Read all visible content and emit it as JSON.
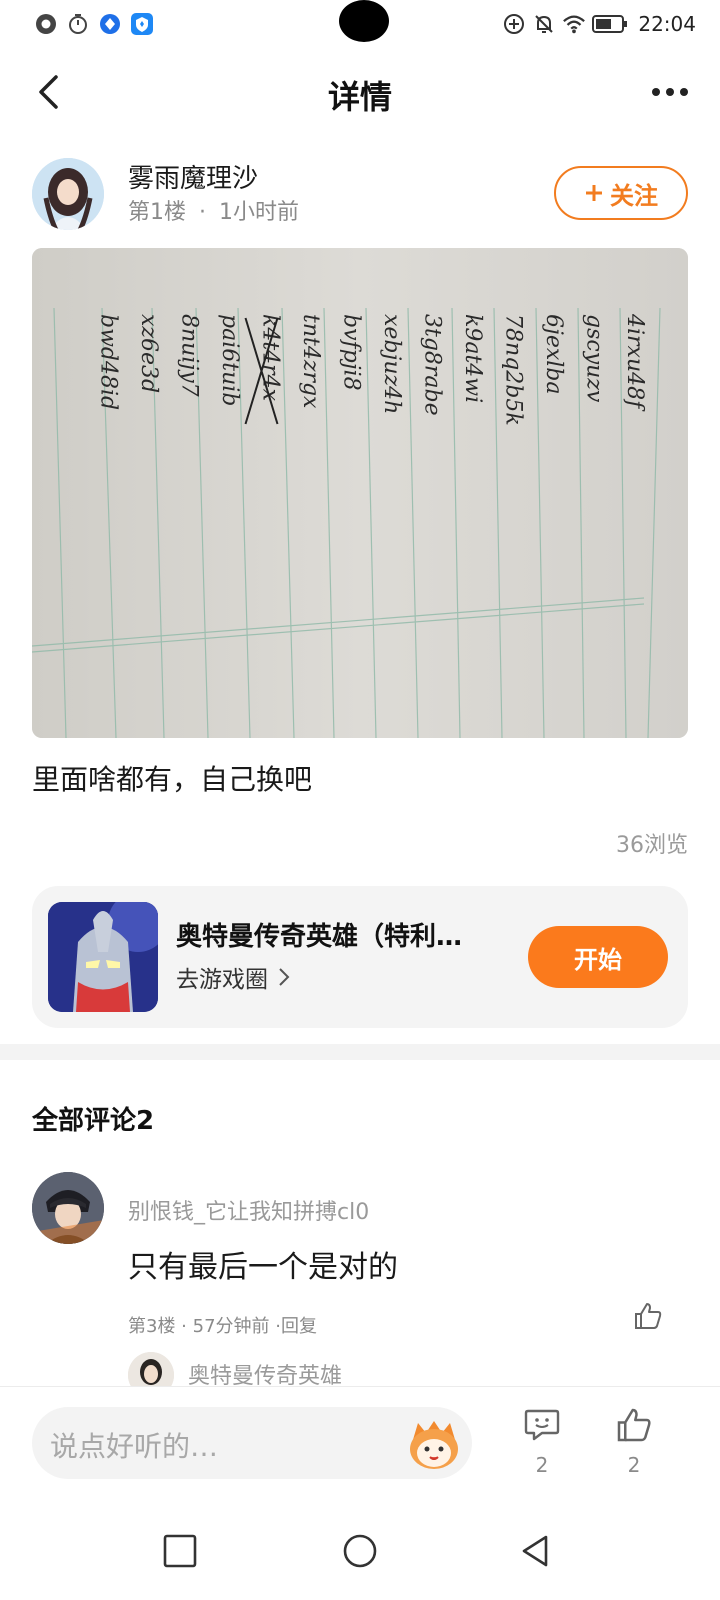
{
  "status_bar": {
    "time": "22:04",
    "icons": [
      "chat-bubble-icon",
      "stopwatch-icon",
      "app-badge-icon",
      "app-badge-icon",
      "add-circle-icon",
      "bell-off-icon",
      "wifi-icon",
      "battery-icon"
    ]
  },
  "header": {
    "title": "详情",
    "back_icon": "chevron-left-icon",
    "more_icon": "more-dots-icon"
  },
  "post": {
    "author_name": "雾雨魔理沙",
    "floor": "第1楼",
    "time_ago": "1小时前",
    "meta_separator": "·",
    "follow_label": "关注",
    "body_text": "里面啥都有，自己换吧",
    "views": "36浏览",
    "image_lines": [
      "4irxu48f",
      "gscyuzv",
      "6jexlba",
      "78nq2b5k",
      "k9at4wi",
      "3tg8rabe",
      "xebjuz4h",
      "bvfpji8",
      "tnt4zrgx",
      "k4t4r4x",
      "pai6tuib",
      "8nuijy7",
      "xz6e3d",
      "bwd48id"
    ]
  },
  "game_card": {
    "name": "奥特曼传奇英雄（特利…",
    "link_label": "去游戏圈",
    "start_label": "开始"
  },
  "comments": {
    "title": "全部评论2",
    "items": [
      {
        "user": "别恨钱_它让我知拼搏cl0",
        "text": "只有最后一个是对的",
        "meta": "第3楼 · 57分钟前 ·回复",
        "reply_preview_name": "奥特曼传奇英雄"
      }
    ]
  },
  "bottom_bar": {
    "input_placeholder": "说点好听的…",
    "comment_count": "2",
    "like_count": "2"
  },
  "colors": {
    "accent": "#fb7a1c",
    "text_primary": "#1a1a1a",
    "text_secondary": "#8a8a8a"
  }
}
